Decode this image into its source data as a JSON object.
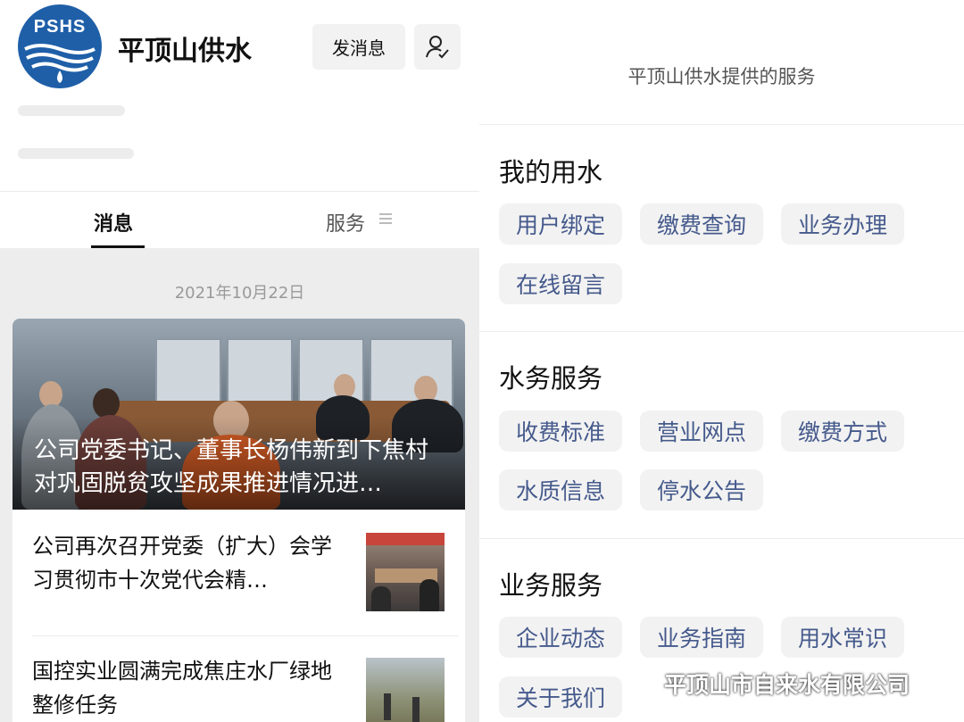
{
  "account": {
    "logo_text": "PSHS",
    "name": "平顶山供水",
    "message_button": "发消息"
  },
  "tabs": {
    "messages": "消息",
    "services": "服务"
  },
  "feed": {
    "date": "2021年10月22日",
    "hero_title": "公司党委书记、董事长杨伟新到下焦村对巩固脱贫攻坚成果推进情况进…",
    "items": [
      {
        "title": "公司再次召开党委（扩大）会学习贯彻市十次党代会精…"
      },
      {
        "title": "国控实业圆满完成焦庄水厂绿地整修任务"
      }
    ]
  },
  "services_panel": {
    "header": "平顶山供水提供的服务",
    "sections": [
      {
        "title": "我的用水",
        "items": [
          "用户绑定",
          "缴费查询",
          "业务办理",
          "在线留言"
        ]
      },
      {
        "title": "水务服务",
        "items": [
          "收费标准",
          "营业网点",
          "缴费方式",
          "水质信息",
          "停水公告"
        ]
      },
      {
        "title": "业务服务",
        "items": [
          "企业动态",
          "业务指南",
          "用水常识",
          "关于我们"
        ]
      }
    ]
  },
  "watermark": "平顶山市自来水有限公司",
  "colors": {
    "logo_blue": "#1f5fa8",
    "chip_text": "#455a8c",
    "chip_bg": "#f2f2f2",
    "feed_bg": "#ededed"
  }
}
